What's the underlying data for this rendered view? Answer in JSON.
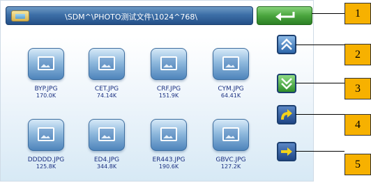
{
  "titlebar": {
    "path": "\\SDM^\\PHOTO测试文件\\1024^768\\",
    "folder_icon": "photo-folder-icon",
    "back_icon": "return-arrow-icon"
  },
  "files": [
    {
      "name": "BYP.JPG",
      "size": "170.0K"
    },
    {
      "name": "CET.JPG",
      "size": "74.14K"
    },
    {
      "name": "CRF.JPG",
      "size": "151.9K"
    },
    {
      "name": "CYM.JPG",
      "size": "64.41K"
    },
    {
      "name": "DDDDD.JPG",
      "size": "125.8K"
    },
    {
      "name": "ED4.JPG",
      "size": "344.8K"
    },
    {
      "name": "ER443.JPG",
      "size": "190.6K"
    },
    {
      "name": "GBVC.JPG",
      "size": "127.2K"
    }
  ],
  "side_buttons": [
    {
      "icon": "double-chevron-up-icon"
    },
    {
      "icon": "double-chevron-down-icon"
    },
    {
      "icon": "curved-arrow-icon"
    },
    {
      "icon": "arrow-right-icon"
    }
  ],
  "callouts": [
    "1",
    "2",
    "3",
    "4",
    "5"
  ],
  "colors": {
    "titlebar": "#3d6fa7",
    "back_button": "#4aa53e",
    "callout": "#f7b100",
    "file_text": "#1a2f80"
  }
}
